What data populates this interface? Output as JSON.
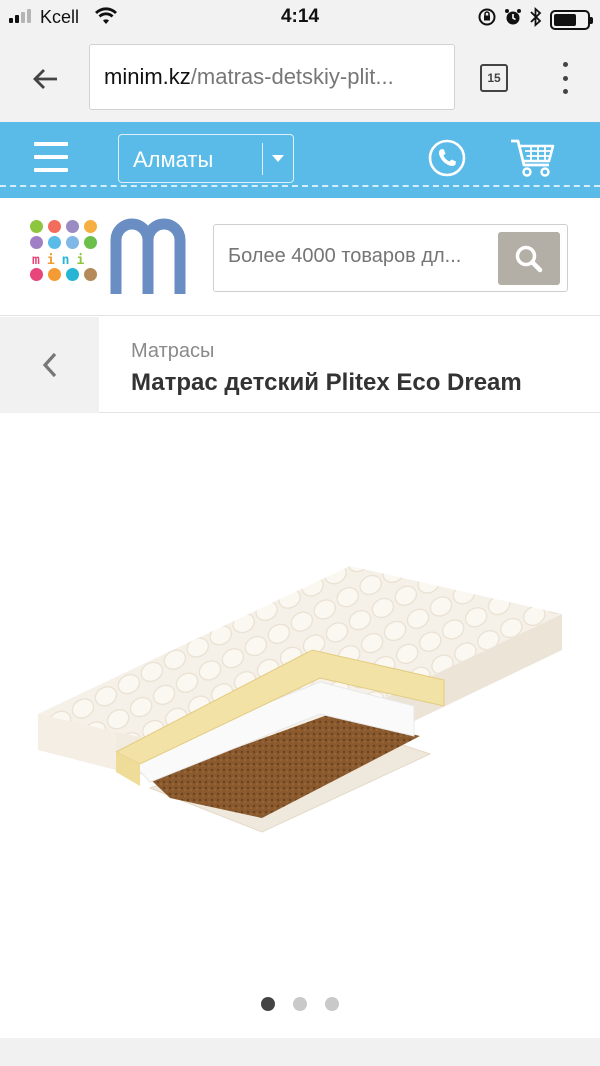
{
  "status_bar": {
    "carrier": "Kcell",
    "time": "4:14",
    "signal_bars_active": 2,
    "signal_bars_total": 4,
    "battery_level": 0.7,
    "icons": [
      "wifi-icon",
      "orientation-lock-icon",
      "alarm-icon",
      "bluetooth-icon",
      "battery-icon"
    ]
  },
  "browser": {
    "url_domain": "minim.kz",
    "url_path": "/matras-detskiy-plit...",
    "tab_count": "15"
  },
  "site_header": {
    "city": "Алматы",
    "bg_color": "#5bbbe8"
  },
  "logo": {
    "word": "mini",
    "letter": "m",
    "brand_color": "#6a8ec4",
    "dot_colors": [
      "#8dc63f",
      "#f26d5b",
      "#9b8bc4",
      "#f5b041",
      "#a17fc6",
      "#5bbbe8",
      "#7fb8e6",
      "#6dbf4b",
      "#e8457a",
      "#f39c34",
      "#27b5d6",
      "#b58a5a"
    ]
  },
  "search": {
    "placeholder": "Более 4000 товаров дл..."
  },
  "breadcrumb": {
    "category": "Матрасы",
    "title": "Матрас детский Plitex Eco Dream"
  },
  "carousel": {
    "total": 3,
    "active_index": 0
  }
}
